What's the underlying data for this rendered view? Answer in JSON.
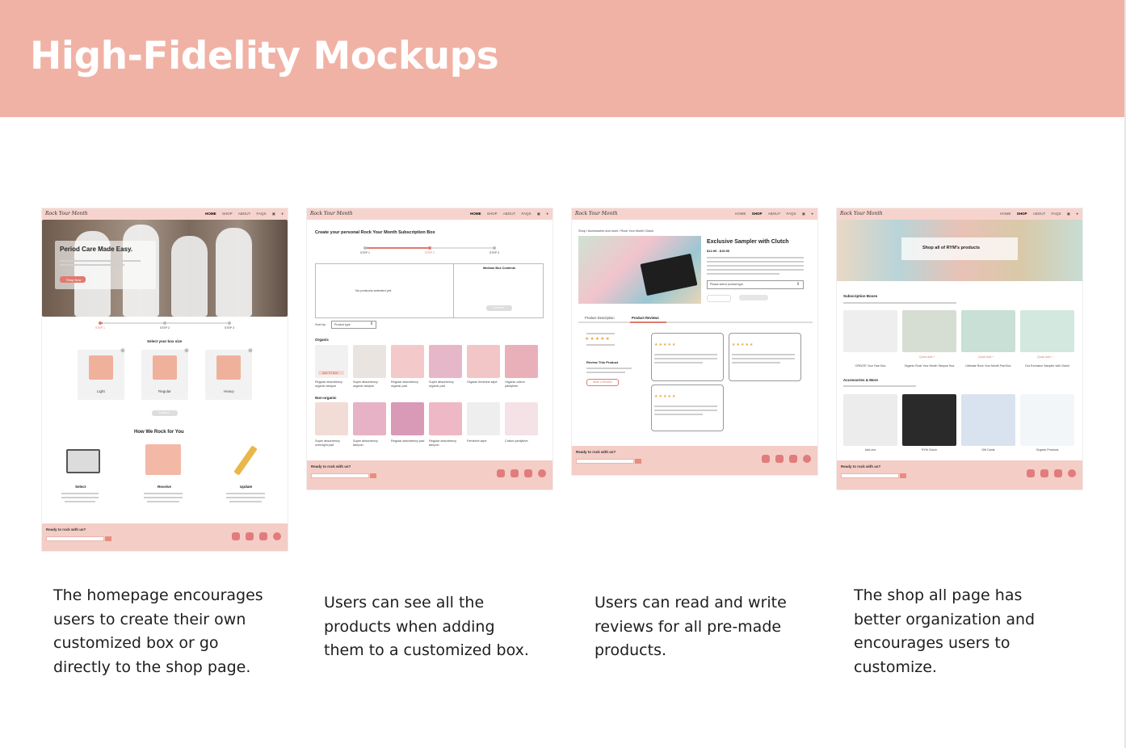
{
  "slide": {
    "title": "High-Fidelity Mockups"
  },
  "mockups": [
    {
      "nav": {
        "logo": "Rock Your Month",
        "links": [
          "HOME",
          "SHOP",
          "ABOUT",
          "FAQS"
        ]
      },
      "hero_title": "Period Care Made Easy.",
      "hero_button": "Shop Now",
      "steps": [
        "STEP 1",
        "STEP 2",
        "STEP 3"
      ],
      "box_heading": "Select your box size",
      "box_sizes": [
        "Light",
        "Regular",
        "Heavy"
      ],
      "continue_button": "Continue",
      "how_heading": "How We Rock for You",
      "how_items": [
        "Select",
        "Receive",
        "Update"
      ],
      "footer_title": "Ready to rock with us?"
    },
    {
      "nav": {
        "logo": "Rock Your Month",
        "links": [
          "HOME",
          "SHOP",
          "ABOUT",
          "FAQS"
        ]
      },
      "page_heading": "Create your personal Rock Your Month Subscription Box",
      "steps": [
        "STEP 1",
        "STEP 2",
        "STEP 3"
      ],
      "empty_text": "No products selected yet.",
      "box_contents_label": "Medium Box Contents",
      "continue_button": "Continue",
      "sort_label": "Sort by:",
      "sort_value": "Product type",
      "add_button": "ADD TO BOX",
      "organic_heading": "Organic",
      "organic_products": [
        "Regular absorbency organic tampon",
        "Super absorbency organic tampon",
        "Regular absorbency organic pad",
        "Super absorbency organic pad",
        "Organic feminine wipe",
        "Organic cotton pantyliner"
      ],
      "nonorganic_heading": "Non-organic",
      "nonorganic_products": [
        "Super absorbency overnight pad",
        "Super absorbency tampon",
        "Regular absorbency pad",
        "Regular absorbency tampon",
        "Feminine wipe",
        "Cotton pantyliner"
      ],
      "footer_title": "Ready to rock with us?"
    },
    {
      "nav": {
        "logo": "Rock Your Month",
        "links": [
          "HOME",
          "SHOP",
          "ABOUT",
          "FAQS"
        ]
      },
      "breadcrumb": "Shop / Accessories and more / Rock Your Month Clutch",
      "product_title": "Exclusive Sampler with Clutch",
      "price": "$12.99 - $15.99",
      "select_placeholder": "Please select product type",
      "tabs": [
        "Product Description",
        "Product Reviews"
      ],
      "review_heading": "Review This Product",
      "write_review_button": "Write a Review",
      "footer_title": "Ready to rock with us?"
    },
    {
      "nav": {
        "logo": "Rock Your Month",
        "links": [
          "HOME",
          "SHOP",
          "ABOUT",
          "FAQS"
        ]
      },
      "hero_text": "Shop all of RYM's products",
      "subscription_heading": "Subscription Boxes",
      "subscription_products": [
        "CREATE Your Own Box",
        "Organic Rock Your Month Tampon Box",
        "Ultimate Rock Your Month Pad Box",
        "Our Exclusive Sampler with Clutch"
      ],
      "quick_add": "Quick Add +",
      "accessories_heading": "Accessories & More",
      "accessories_products": [
        "Add-ons",
        "RYM Clutch",
        "Gift Cards",
        "Organic Products"
      ],
      "footer_title": "Ready to rock with us?"
    }
  ],
  "captions": [
    [
      "The homepage encourages",
      "users to create their own",
      "customized box or go",
      "directly to the shop page."
    ],
    [
      "Users can see all the",
      "products when adding",
      "them to a customized box."
    ],
    [
      "Users can read and write",
      "reviews for all pre-made",
      "products."
    ],
    [
      "The shop all page has",
      "better organization and",
      "encourages users to",
      "customize."
    ]
  ],
  "colors": {
    "banner": "#f0b2a5",
    "accent": "#e07a6f",
    "nav": "#f6d4cd"
  }
}
